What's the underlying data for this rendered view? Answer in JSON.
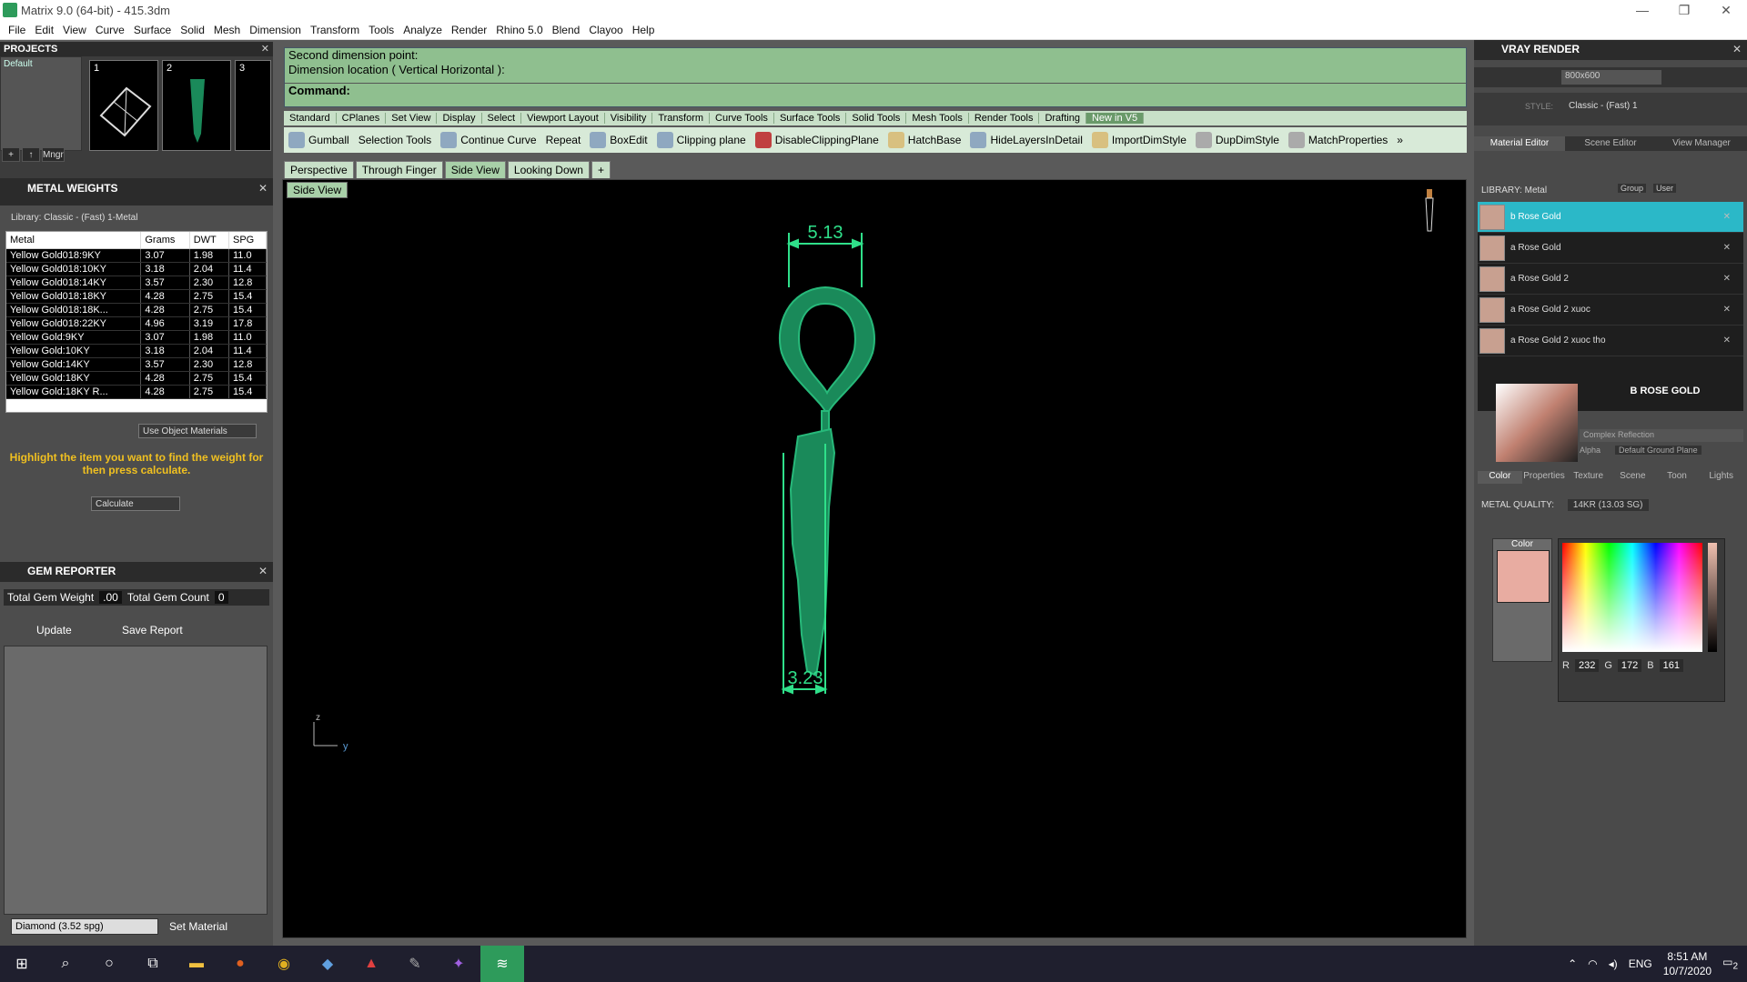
{
  "window": {
    "title": "Matrix 9.0 (64-bit) - 415.3dm",
    "min": "—",
    "max": "❐",
    "close": "✕"
  },
  "menu": [
    "File",
    "Edit",
    "View",
    "Curve",
    "Surface",
    "Solid",
    "Mesh",
    "Dimension",
    "Transform",
    "Tools",
    "Analyze",
    "Render",
    "Rhino 5.0",
    "Blend",
    "Clayoo",
    "Help"
  ],
  "projects": {
    "title": "PROJECTS",
    "item": "Default",
    "thumb_numbers": [
      "1",
      "2",
      "3"
    ],
    "mgr": "Mngr"
  },
  "metal_weights": {
    "title": "METAL WEIGHTS",
    "library": "Library: Classic - (Fast) 1-Metal",
    "columns": [
      "Metal",
      "Grams",
      "DWT",
      "SPG"
    ],
    "rows": [
      [
        "Yellow Gold018:9KY",
        "3.07",
        "1.98",
        "11.0"
      ],
      [
        "Yellow Gold018:10KY",
        "3.18",
        "2.04",
        "11.4"
      ],
      [
        "Yellow Gold018:14KY",
        "3.57",
        "2.30",
        "12.8"
      ],
      [
        "Yellow Gold018:18KY",
        "4.28",
        "2.75",
        "15.4"
      ],
      [
        "Yellow Gold018:18K...",
        "4.28",
        "2.75",
        "15.4"
      ],
      [
        "Yellow Gold018:22KY",
        "4.96",
        "3.19",
        "17.8"
      ],
      [
        "Yellow Gold:9KY",
        "3.07",
        "1.98",
        "11.0"
      ],
      [
        "Yellow Gold:10KY",
        "3.18",
        "2.04",
        "11.4"
      ],
      [
        "Yellow Gold:14KY",
        "3.57",
        "2.30",
        "12.8"
      ],
      [
        "Yellow Gold:18KY",
        "4.28",
        "2.75",
        "15.4"
      ],
      [
        "Yellow Gold:18KY R...",
        "4.28",
        "2.75",
        "15.4"
      ]
    ],
    "use_object_materials": "Use Object Materials",
    "highlight_text": "Highlight the item you want to find the weight for then press calculate.",
    "calculate": "Calculate"
  },
  "gem_reporter": {
    "title": "GEM REPORTER",
    "total_weight_label": "Total Gem Weight",
    "total_weight": ".00",
    "total_count_label": "Total Gem Count",
    "total_count": "0",
    "update": "Update",
    "save_report": "Save Report",
    "diamond": "Diamond    (3.52 spg)",
    "set_material": "Set Material"
  },
  "command": {
    "line1": "Second dimension point:",
    "line2": "Dimension location ( Vertical  Horizontal ):",
    "prompt": "Command:"
  },
  "tool_tabs": [
    "Standard",
    "CPlanes",
    "Set View",
    "Display",
    "Select",
    "Viewport Layout",
    "Visibility",
    "Transform",
    "Curve Tools",
    "Surface Tools",
    "Solid Tools",
    "Mesh Tools",
    "Render Tools",
    "Drafting",
    "New in V5"
  ],
  "tools": [
    "Gumball",
    "Selection Tools",
    "Continue Curve",
    "Repeat",
    "BoxEdit",
    "Clipping plane",
    "DisableClippingPlane",
    "HatchBase",
    "HideLayersInDetail",
    "ImportDimStyle",
    "DupDimStyle",
    "MatchProperties"
  ],
  "view_tabs": [
    "Perspective",
    "Through Finger",
    "Side View",
    "Looking Down"
  ],
  "viewport": {
    "label": "Side View",
    "dim_top": "5.13",
    "dim_bottom": "3.23",
    "axis_z": "z",
    "axis_y": "y"
  },
  "vray": {
    "title": "VRAY RENDER",
    "resolution": "800x600",
    "style_label": "STYLE:",
    "style": "Classic - (Fast) 1",
    "tabs": [
      "Material Editor",
      "Scene Editor",
      "View Manager"
    ],
    "library": "LIBRARY: Metal",
    "group": "Group",
    "user": "User",
    "materials": [
      "b Rose Gold",
      "a Rose Gold",
      "a Rose Gold 2",
      "a Rose Gold 2 xuoc",
      "a Rose Gold 2 xuoc tho"
    ],
    "material_name": "B ROSE GOLD",
    "reflection": "Complex Reflection",
    "alpha": "Alpha",
    "ground": "Default Ground Plane",
    "color_tabs": [
      "Color",
      "Properties",
      "Texture",
      "Scene",
      "Toon",
      "Lights"
    ],
    "metal_quality_label": "METAL QUALITY:",
    "metal_quality": "14KR      (13.03 SG)",
    "color_label": "Color",
    "r": "232",
    "g": "172",
    "b": "161",
    "swatch": "#e8aca1"
  },
  "taskbar": {
    "lang": "ENG",
    "time": "8:51 AM",
    "date": "10/7/2020",
    "notif": "2"
  }
}
